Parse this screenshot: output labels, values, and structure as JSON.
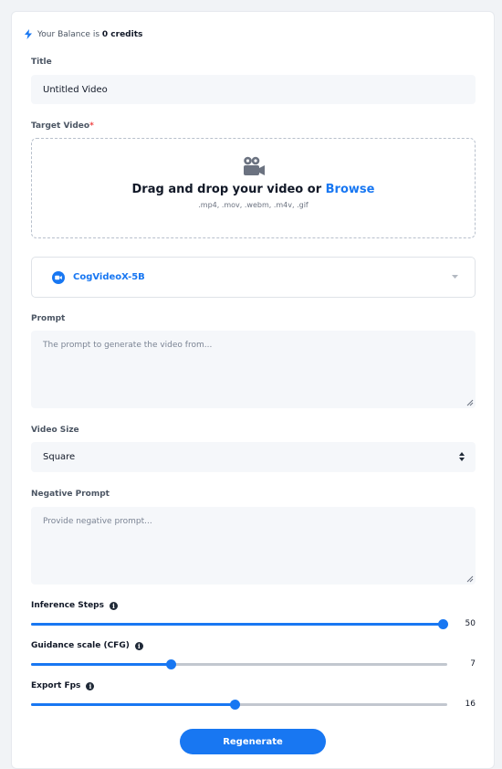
{
  "balance": {
    "prefix": "Your Balance is",
    "amount": "0 credits",
    "icon": "lightning-icon",
    "icon_color": "#1877f2"
  },
  "title_field": {
    "label": "Title",
    "value": "Untitled Video"
  },
  "target_video": {
    "label": "Target Video",
    "required_mark": "*",
    "drop_text": "Drag and drop your video or",
    "browse_label": "Browse",
    "formats": ".mp4, .mov, .webm, .m4v, .gif",
    "icon": "video-camera-icon"
  },
  "model": {
    "name": "CogVideoX-5B",
    "icon": "zoom-camera-icon"
  },
  "prompt": {
    "label": "Prompt",
    "placeholder": "The prompt to generate the video from..."
  },
  "video_size": {
    "label": "Video Size",
    "value": "Square"
  },
  "negative_prompt": {
    "label": "Negative Prompt",
    "placeholder": "Provide negative prompt..."
  },
  "sliders": [
    {
      "label": "Inference Steps",
      "value": "50",
      "fraction": 1.0
    },
    {
      "label": "Guidance scale (CFG)",
      "value": "7",
      "fraction": 0.335
    },
    {
      "label": "Export Fps",
      "value": "16",
      "fraction": 0.488
    }
  ],
  "regenerate_label": "Regenerate",
  "colors": {
    "accent": "#1877f2",
    "required": "#ef4444"
  }
}
